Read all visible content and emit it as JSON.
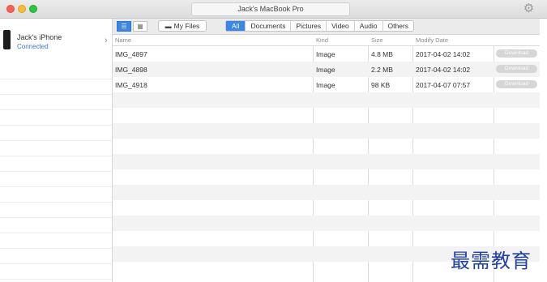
{
  "window": {
    "title": "Jack's MacBook Pro"
  },
  "sidebar": {
    "device": {
      "name": "Jack's iPhone",
      "status": "Connected"
    }
  },
  "toolbar": {
    "my_files_label": "My Files",
    "filters": [
      "All",
      "Documents",
      "Pictures",
      "Video",
      "Audio",
      "Others"
    ],
    "active_filter": "All"
  },
  "table": {
    "columns": [
      "Name",
      "Kind",
      "Size",
      "Modify Date"
    ],
    "rows": [
      {
        "name": "IMG_4897",
        "kind": "Image",
        "size": "4.8 MB",
        "date": "2017-04-02 14:02",
        "action": "Download"
      },
      {
        "name": "IMG_4898",
        "kind": "Image",
        "size": "2.2 MB",
        "date": "2017-04-02 14:02",
        "action": "Download"
      },
      {
        "name": "IMG_4918",
        "kind": "Image",
        "size": "98 KB",
        "date": "2017-04-07 07:57",
        "action": "Download"
      }
    ]
  },
  "watermark": "最需教育",
  "colors": {
    "accent": "#3b87e8",
    "connected": "#3778d6",
    "watermark": "#1f3fa8"
  }
}
